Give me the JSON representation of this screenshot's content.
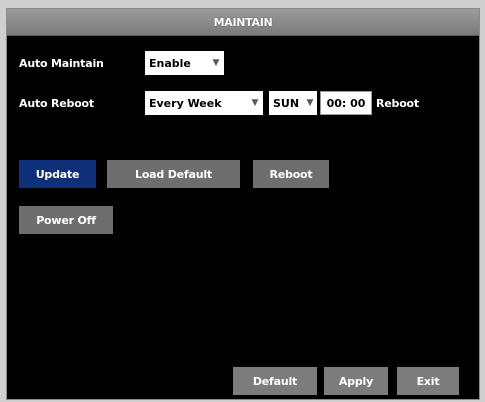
{
  "window": {
    "title": "MAINTAIN"
  },
  "auto_maintain": {
    "label": "Auto Maintain",
    "value": "Enable"
  },
  "auto_reboot": {
    "label": "Auto Reboot",
    "frequency": "Every Week",
    "day": "SUN",
    "time": "00: 00",
    "suffix": "Reboot"
  },
  "actions": {
    "update": "Update",
    "load_default": "Load Default",
    "reboot": "Reboot",
    "power_off": "Power Off"
  },
  "footer": {
    "default": "Default",
    "apply": "Apply",
    "exit": "Exit"
  },
  "icons": {
    "dropdown": "dropdown-arrow-icon"
  },
  "colors": {
    "selected_button": "#0e2f7a",
    "button": "#6e6e6e",
    "background": "#000000"
  }
}
